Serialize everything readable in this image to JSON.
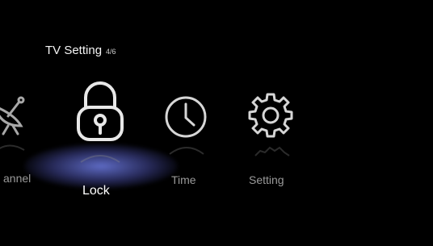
{
  "header": {
    "title": "TV Setting",
    "page_indicator": "4/6"
  },
  "menu": {
    "items": [
      {
        "label": "annel",
        "icon": "satellite-dish-icon",
        "selected": false
      },
      {
        "label": "Lock",
        "icon": "padlock-icon",
        "selected": true
      },
      {
        "label": "Time",
        "icon": "clock-icon",
        "selected": false
      },
      {
        "label": "Setting",
        "icon": "gear-icon",
        "selected": false
      }
    ]
  },
  "colors": {
    "background": "#000000",
    "selected_text": "#ffffff",
    "unselected_text": "#9a9a9a",
    "highlight_glow": "#6e7de6"
  }
}
